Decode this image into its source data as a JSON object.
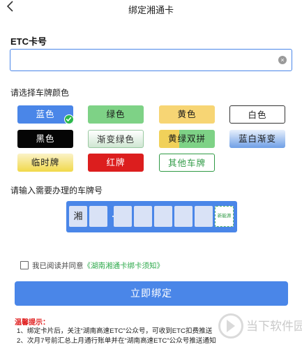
{
  "nav": {
    "title": "绑定湘通卡"
  },
  "etc": {
    "label": "ETC卡号",
    "value": "",
    "placeholder": ""
  },
  "color_section": {
    "label": "请选择车牌颜色"
  },
  "plate_colors": [
    {
      "label": "蓝色",
      "selected": true,
      "bg": "#4a86e8",
      "color": "#ffffff"
    },
    {
      "label": "绿色",
      "selected": false,
      "bg": "#7ed286",
      "color": "#1a1a1a"
    },
    {
      "label": "黄色",
      "selected": false,
      "bg": "#f7d574",
      "color": "#1a1a1a"
    },
    {
      "label": "白色",
      "selected": false,
      "bg": "#ffffff",
      "color": "#222222"
    },
    {
      "label": "黑色",
      "selected": false,
      "bg": "#050505",
      "color": "#ffffff"
    },
    {
      "label": "渐变绿色",
      "selected": false,
      "bg": "#f2f8f2",
      "color": "#333333"
    },
    {
      "label": "黄绿双拼",
      "selected": false,
      "bg": "#f1d15a",
      "color": "#1a1a1a"
    },
    {
      "label": "蓝白渐变",
      "selected": false,
      "bg": "#7aa7e9",
      "color": "#1a1a1a"
    },
    {
      "label": "临时牌",
      "selected": false,
      "bg": "#f5e97a",
      "color": "#1a1a1a"
    },
    {
      "label": "红牌",
      "selected": false,
      "bg": "#dc1e1e",
      "color": "#ffffff"
    },
    {
      "label": "其他车牌",
      "selected": false,
      "bg": "#ffffff",
      "color": "#2f9a45"
    }
  ],
  "plate_section": {
    "label": "请输入需要办理的车牌号"
  },
  "plate_input": {
    "province": "湘",
    "cells": [
      "",
      "",
      "",
      "",
      "",
      ""
    ],
    "new_energy_label": "新能源"
  },
  "agreement": {
    "prefix": "我已阅读并同意",
    "link": "《湖南湘通卡绑卡须知》",
    "checked": false
  },
  "bind_button": {
    "label": "立即绑定"
  },
  "tips": {
    "title": "温馨提示：",
    "items": [
      "1、绑定卡片后，关注“湖南高速ETC”公众号，可收到ETC扣费推送",
      "2、次月7号前汇总上月通行账单并在“湖南高速ETC”公众号推送通知"
    ]
  },
  "watermark": {
    "text": "当下软件园"
  },
  "colors": {
    "accent": "#4a86e8",
    "link_green": "#2ca94a",
    "warning_red": "#e02020"
  }
}
